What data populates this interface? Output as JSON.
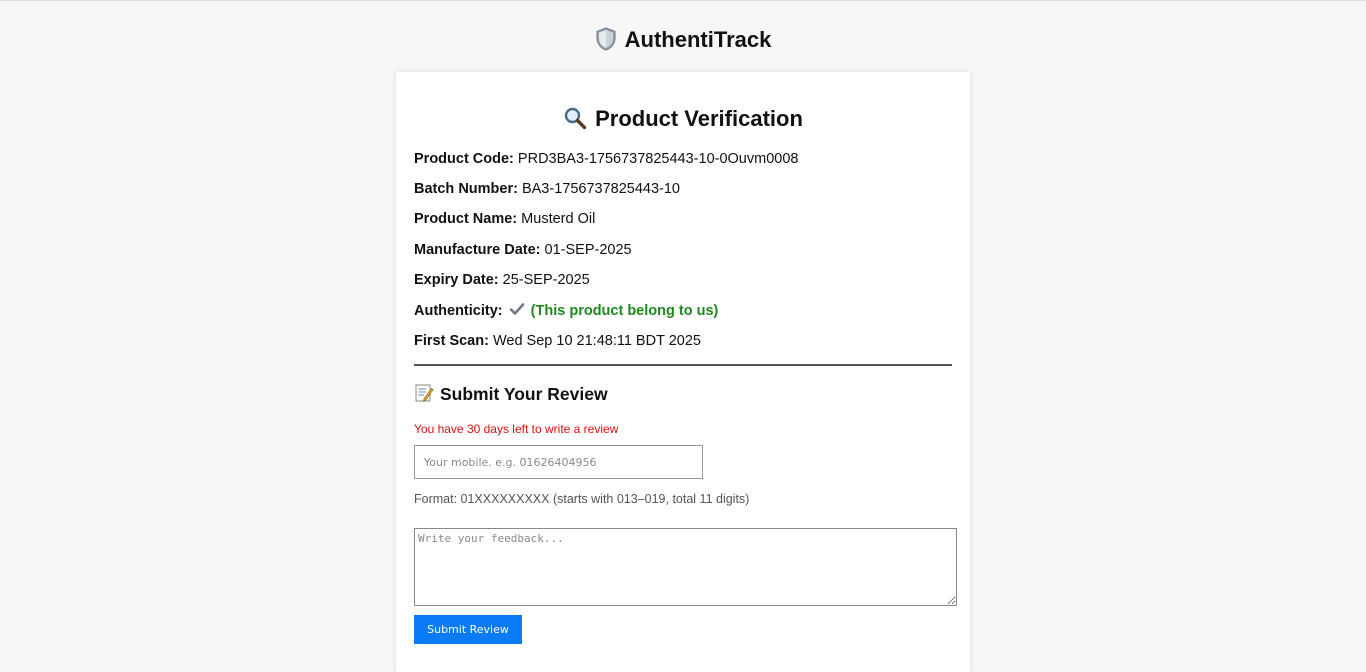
{
  "app": {
    "title": "AuthentiTrack",
    "logo_icon": "shield-icon"
  },
  "verification": {
    "title": "Product Verification",
    "title_icon": "magnifier-icon",
    "fields": {
      "product_code": {
        "label": "Product Code:",
        "value": "PRD3BA3-1756737825443-10-0Ouvm0008"
      },
      "batch_number": {
        "label": "Batch Number:",
        "value": "BA3-1756737825443-10"
      },
      "product_name": {
        "label": "Product Name:",
        "value": "Musterd Oil"
      },
      "manufacture_date": {
        "label": "Manufacture Date:",
        "value": "01-SEP-2025"
      },
      "expiry_date": {
        "label": "Expiry Date:",
        "value": "25-SEP-2025"
      },
      "authenticity": {
        "label": "Authenticity:",
        "value": "(This product belong to us)",
        "icon": "checkmark-icon",
        "color": "#1e8a1e"
      },
      "first_scan": {
        "label": "First Scan:",
        "value": "Wed Sep 10 21:48:11 BDT 2025"
      }
    }
  },
  "review": {
    "title": "Submit Your Review",
    "title_icon": "memo-icon",
    "days_left": "You have 30 days left to write a review",
    "days_left_color": "#e01010",
    "mobile_placeholder": "Your mobile. e.g. 01626404956",
    "mobile_value": "",
    "format_hint": "Format: 01XXXXXXXXX (starts with 013–019, total 11 digits)",
    "feedback_placeholder": "Write your feedback...",
    "feedback_value": "",
    "submit_label": "Submit Review",
    "submit_color": "#0a7bf5"
  }
}
